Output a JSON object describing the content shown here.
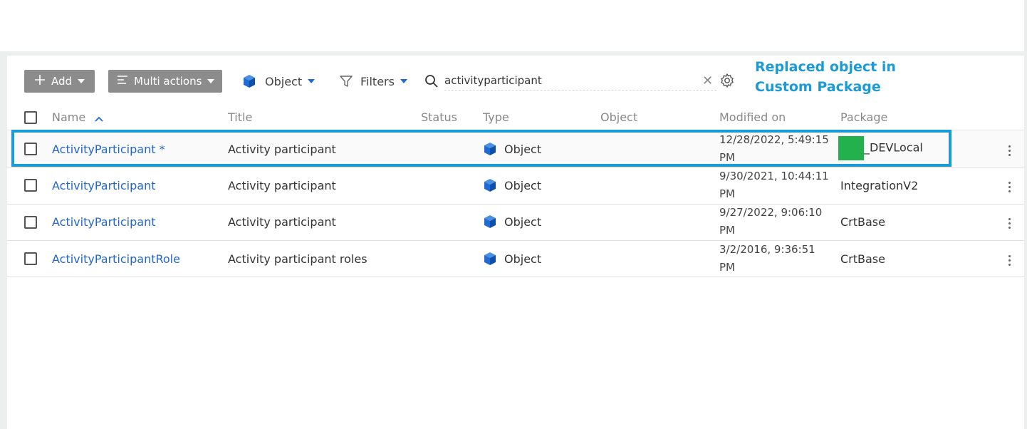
{
  "toolbar": {
    "add_label": "Add",
    "multi_actions_label": "Multi actions",
    "object_filter_label": "Object",
    "filters_label": "Filters"
  },
  "search": {
    "value": "activityparticipant"
  },
  "annotation": {
    "line1": "Replaced object in",
    "line2": "Custom Package",
    "color": "#1a9ad6"
  },
  "table": {
    "headers": {
      "name": "Name",
      "title": "Title",
      "status": "Status",
      "type": "Type",
      "object": "Object",
      "modified_on": "Modified on",
      "package": "Package"
    },
    "sort_icon": "chevron-up-icon",
    "rows": [
      {
        "name": "ActivityParticipant *",
        "title": "Activity participant",
        "status": "",
        "type": "Object",
        "object": "",
        "modified_on": "12/28/2022, 5:49:15 PM",
        "package": "_DEVLocal"
      },
      {
        "name": "ActivityParticipant",
        "title": "Activity participant",
        "status": "",
        "type": "Object",
        "object": "",
        "modified_on": "9/30/2021, 10:44:11 PM",
        "package": "IntegrationV2"
      },
      {
        "name": "ActivityParticipant",
        "title": "Activity participant",
        "status": "",
        "type": "Object",
        "object": "",
        "modified_on": "9/27/2022, 9:06:10 PM",
        "package": "CrtBase"
      },
      {
        "name": "ActivityParticipantRole",
        "title": "Activity participant roles",
        "status": "",
        "type": "Object",
        "object": "",
        "modified_on": "3/2/2016, 9:36:51 PM",
        "package": "CrtBase"
      }
    ]
  },
  "colors": {
    "accent": "#1f6bd6",
    "link": "#2266cc",
    "button_gray": "#8c8c8c",
    "redaction_green": "#22b14c"
  }
}
